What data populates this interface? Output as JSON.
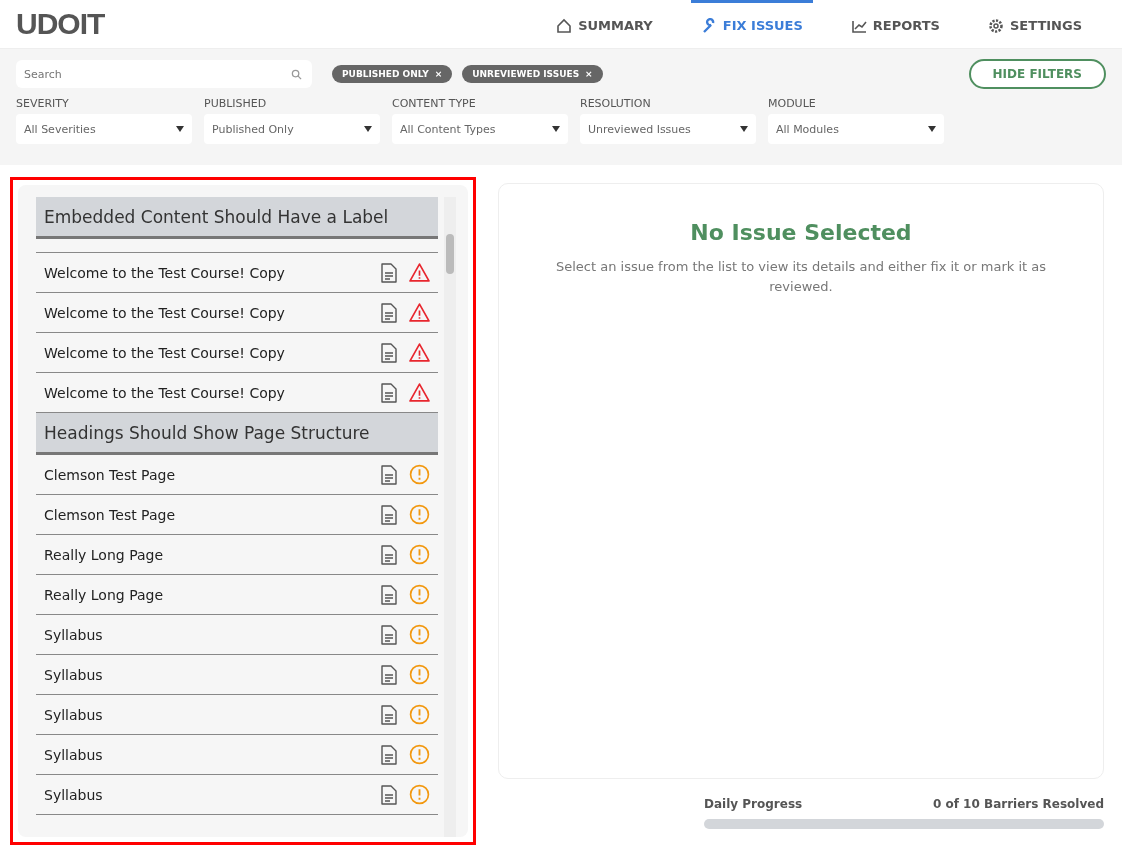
{
  "logo": "UDOIT",
  "nav": [
    {
      "label": "SUMMARY",
      "kind": "home",
      "selected": false
    },
    {
      "label": "FIX ISSUES",
      "kind": "wrench",
      "selected": true
    },
    {
      "label": "REPORTS",
      "kind": "chart",
      "selected": false
    },
    {
      "label": "SETTINGS",
      "kind": "gear",
      "selected": false
    }
  ],
  "search": {
    "placeholder": "Search"
  },
  "active_filters": [
    {
      "label": "PUBLISHED ONLY",
      "remove": "×"
    },
    {
      "label": "UNREVIEWED ISSUES",
      "remove": "×"
    }
  ],
  "hide_filters_button": "HIDE FILTERS",
  "filters": [
    {
      "label": "SEVERITY",
      "value": "All Severities"
    },
    {
      "label": "PUBLISHED",
      "value": "Published Only"
    },
    {
      "label": "CONTENT TYPE",
      "value": "All Content Types"
    },
    {
      "label": "RESOLUTION",
      "value": "Unreviewed Issues"
    },
    {
      "label": "MODULE",
      "value": "All Modules"
    }
  ],
  "issue_groups": [
    {
      "title": "Embedded Content Should Have a Label",
      "items": [
        {
          "title": "Welcome to the Test Course! Copy",
          "kind": "error"
        },
        {
          "title": "Welcome to the Test Course! Copy",
          "kind": "error"
        },
        {
          "title": "Welcome to the Test Course! Copy",
          "kind": "error"
        },
        {
          "title": "Welcome to the Test Course! Copy",
          "kind": "error"
        }
      ]
    },
    {
      "title": "Headings Should Show Page Structure",
      "items": [
        {
          "title": "Clemson Test Page",
          "kind": "suggestion"
        },
        {
          "title": "Clemson Test Page",
          "kind": "suggestion"
        },
        {
          "title": "Really Long Page",
          "kind": "suggestion"
        },
        {
          "title": "Really Long Page",
          "kind": "suggestion"
        },
        {
          "title": "Syllabus",
          "kind": "suggestion"
        },
        {
          "title": "Syllabus",
          "kind": "suggestion"
        },
        {
          "title": "Syllabus",
          "kind": "suggestion"
        },
        {
          "title": "Syllabus",
          "kind": "suggestion"
        },
        {
          "title": "Syllabus",
          "kind": "suggestion"
        }
      ]
    }
  ],
  "detail": {
    "title": "No Issue Selected",
    "message": "Select an issue from the list to view its details and either fix it or mark it as reviewed."
  },
  "progress": {
    "label": "Daily Progress",
    "reading": "0 of 10 Barriers Resolved",
    "level": 0
  }
}
